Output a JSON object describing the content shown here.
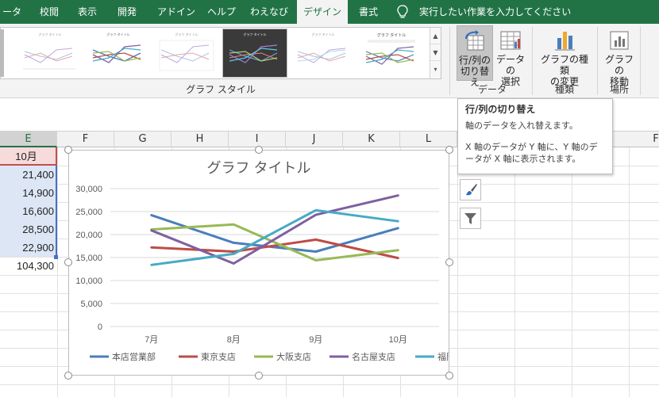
{
  "ribbon_tabs": [
    {
      "label": "ータ",
      "active": false
    },
    {
      "label": "校閲",
      "active": false
    },
    {
      "label": "表示",
      "active": false
    },
    {
      "label": "開発",
      "active": false
    },
    {
      "label": "アドイン",
      "active": false
    },
    {
      "label": "ヘルプ",
      "active": false
    },
    {
      "label": "わえなび",
      "active": false
    },
    {
      "label": "デザイン",
      "active": true
    },
    {
      "label": "書式",
      "active": false
    }
  ],
  "tell_me": "実行したい作業を入力してください",
  "chart_styles": {
    "group_label": "グラフ スタイル",
    "thumb_title": "グラフ タイトル"
  },
  "data_group": {
    "label": "データ",
    "switch_row_col": {
      "line1": "行/列の",
      "line2": "切り替え"
    },
    "select_data": {
      "line1": "データの",
      "line2": "選択"
    }
  },
  "type_group": {
    "label": "種類",
    "change_type": {
      "line1": "グラフの種類",
      "line2": "の変更"
    }
  },
  "location_group": {
    "label": "場所",
    "move_chart": {
      "line1": "グラフの",
      "line2": "移動"
    }
  },
  "tooltip": {
    "title": "行/列の切り替え",
    "line1": "軸のデータを入れ替えます。",
    "line2": "X 軸のデータが Y 軸に、Y 軸のデータが X 軸に表示されます。"
  },
  "columns": [
    "E",
    "F",
    "G",
    "H",
    "I",
    "J",
    "K",
    "L",
    "F"
  ],
  "column_e": {
    "header": "10月",
    "values": [
      "21,400",
      "14,900",
      "16,600",
      "28,500",
      "22,900"
    ],
    "total": "104,300"
  },
  "colors": {
    "excel_green": "#217346",
    "series": [
      "#4a7ebb",
      "#be4b48",
      "#98b954",
      "#7d60a0",
      "#46aac5"
    ]
  },
  "chart_data": {
    "type": "line",
    "title": "グラフ タイトル",
    "categories": [
      "7月",
      "8月",
      "9月",
      "10月"
    ],
    "ylim": [
      0,
      30000
    ],
    "yticks": [
      0,
      5000,
      10000,
      15000,
      20000,
      25000,
      30000
    ],
    "ytick_labels": [
      "0",
      "5,000",
      "10,000",
      "15,000",
      "20,000",
      "25,000",
      "30,000"
    ],
    "grid": true,
    "legend": "bottom",
    "series": [
      {
        "name": "本店営業部",
        "values": [
          24200,
          18200,
          16300,
          21400
        ]
      },
      {
        "name": "東京支店",
        "values": [
          17200,
          16300,
          18900,
          14900
        ]
      },
      {
        "name": "大阪支店",
        "values": [
          21100,
          22200,
          14400,
          16600
        ]
      },
      {
        "name": "名古屋支店",
        "values": [
          20900,
          13700,
          24300,
          28500
        ]
      },
      {
        "name": "福岡支店",
        "values": [
          13400,
          15800,
          25300,
          22900
        ]
      }
    ]
  }
}
